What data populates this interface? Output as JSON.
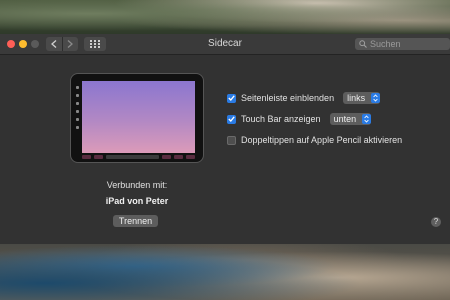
{
  "window": {
    "title": "Sidecar",
    "search_placeholder": "Suchen"
  },
  "device": {
    "connected_label": "Verbunden mit:",
    "device_name": "iPad von Peter",
    "disconnect_label": "Trennen"
  },
  "options": {
    "sidebar": {
      "label": "Seitenleiste einblenden",
      "checked": true,
      "select_value": "links"
    },
    "touchbar": {
      "label": "Touch Bar anzeigen",
      "checked": true,
      "select_value": "unten"
    },
    "double_tap": {
      "label": "Doppeltippen auf Apple Pencil aktivieren",
      "checked": false
    }
  },
  "help": {
    "label": "?"
  },
  "colors": {
    "accent": "#2a7be4",
    "window_bg": "#323232"
  },
  "icons": [
    "close-icon",
    "minimize-icon",
    "maximize-icon",
    "chevron-left-icon",
    "chevron-right-icon",
    "grid-icon",
    "search-icon",
    "checkmark-icon",
    "stepper-icon"
  ]
}
